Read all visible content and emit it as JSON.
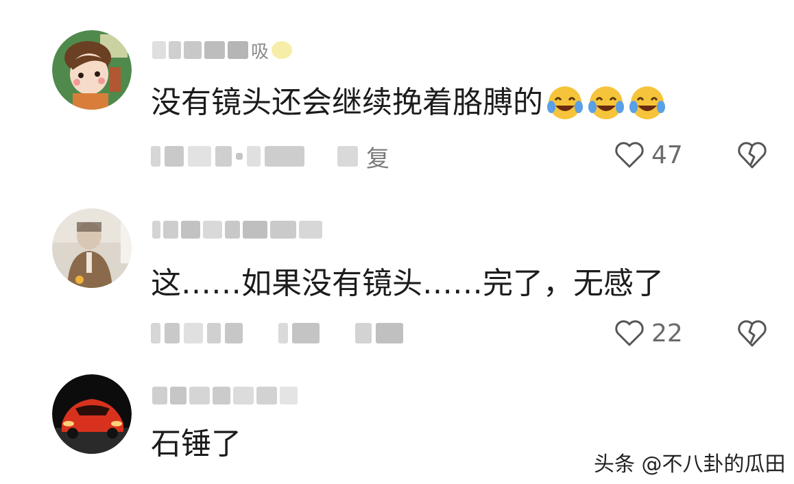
{
  "comments": [
    {
      "username_visible": "吸",
      "text": "没有镜头还会继续挽着胳膊的",
      "emoji_count": 3,
      "reply_label": "复",
      "likes": "47"
    },
    {
      "text": "这……如果没有镜头……完了，无感了",
      "likes": "22"
    },
    {
      "text": "石锤了"
    }
  ],
  "watermark": "头条 @不八卦的瓜田",
  "colors": {
    "background": "#ffffff",
    "text": "#1c1c1c",
    "meta_gray": "#7a7a7a",
    "emoji_yellow": "#f6c43a"
  },
  "icons": [
    "heart-outline-icon",
    "broken-heart-icon",
    "laughing-crying-emoji-icon"
  ]
}
